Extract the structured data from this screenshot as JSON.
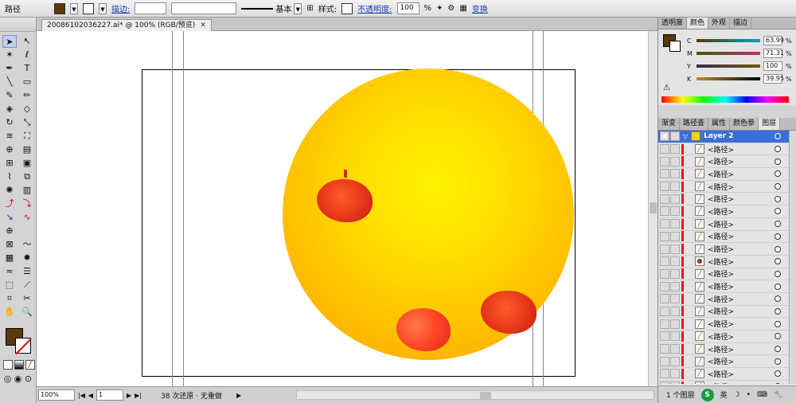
{
  "control_bar": {
    "selection_label": "路径",
    "stroke_link": "描边:",
    "stroke_style": "基本",
    "style_label": "样式:",
    "opacity_link": "不透明度:",
    "opacity_value": "100",
    "opacity_unit": "%",
    "transform_link": "变换"
  },
  "document": {
    "tab_title": "20086102036227.ai* @ 100% (RGB/预览)",
    "tab_close": "✕"
  },
  "status_bar": {
    "zoom": "100%",
    "page": "1",
    "history": "38 次还原 · 无重做"
  },
  "color_panel": {
    "tabs": [
      "透明度",
      "颜色",
      "外观",
      "描边"
    ],
    "active_tab": "颜色",
    "channels": [
      {
        "label": "C",
        "value": "63.99"
      },
      {
        "label": "M",
        "value": "71.31"
      },
      {
        "label": "Y",
        "value": "100"
      },
      {
        "label": "K",
        "value": "39.95"
      }
    ],
    "unit": "%",
    "fill_color": "#5a3a0a"
  },
  "layers_panel": {
    "tabs": [
      "渐变",
      "路径查",
      "属性",
      "颜色参",
      "图层"
    ],
    "active_tab": "图层",
    "layer_name": "Layer 2",
    "items": [
      "<路径>",
      "<路径>",
      "<路径>",
      "<路径>",
      "<路径>",
      "<路径>",
      "<路径>",
      "<路径>",
      "<路径>",
      "<路径>",
      "<路径>",
      "<路径>",
      "<路径>",
      "<路径>",
      "<路径>",
      "<路径>",
      "<路径>",
      "<路径>",
      "<路径>",
      "<路径>"
    ],
    "footer": "1 个图层",
    "ime_label": "S",
    "ime_mode": "英"
  },
  "colors": {
    "fill": "#5a3a0a",
    "selection": "#3a6fd8",
    "layer_color": "#e01c1c"
  }
}
